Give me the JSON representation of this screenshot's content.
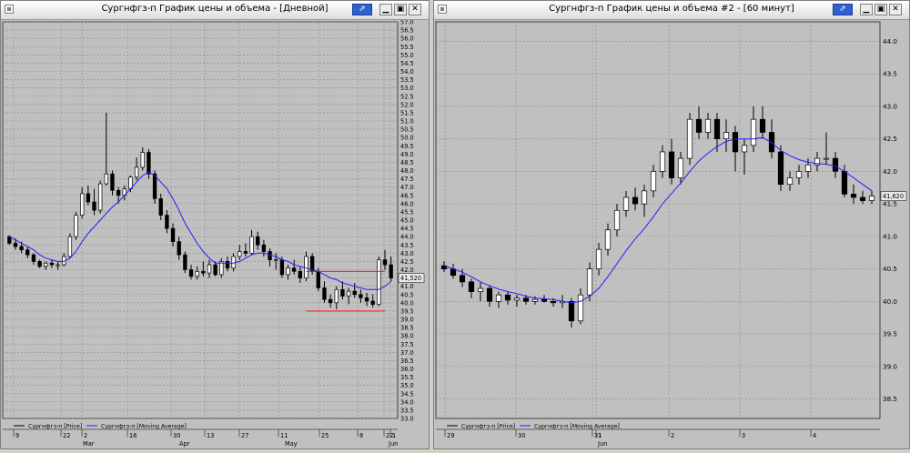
{
  "windows": {
    "left": {
      "title": "Сургнфгз-п График цены и объема - [Дневной]",
      "buttons": {
        "pin": "⇗",
        "minimize": "▁",
        "maximize": "▣",
        "close": "✕"
      }
    },
    "right": {
      "title": "Сургнфгз-п График цены и объема #2 - [60 минут]",
      "buttons": {
        "pin": "⇗",
        "minimize": "▁",
        "maximize": "▣",
        "close": "✕"
      }
    }
  },
  "colors": {
    "price": "#000000",
    "moving_average": "#2020ff",
    "grid": "#8a8a8a",
    "plot_bg": "#c0c0c0",
    "box": "#ff0000"
  },
  "chart_data": [
    {
      "type": "candlestick",
      "interval": "daily",
      "ylim": [
        33.0,
        57.0
      ],
      "y_ticks": [
        "57.0",
        "56.5",
        "56.0",
        "55.5",
        "55.0",
        "54.5",
        "54.0",
        "53.5",
        "53.0",
        "52.5",
        "52.0",
        "51.5",
        "51.0",
        "50.5",
        "50.0",
        "49.5",
        "49.0",
        "48.5",
        "48.0",
        "47.5",
        "47.0",
        "46.5",
        "46.0",
        "45.5",
        "45.0",
        "44.5",
        "44.0",
        "43.5",
        "43.0",
        "42.5",
        "42.0",
        "41.5",
        "41.0",
        "40.5",
        "40.0",
        "39.5",
        "39.0",
        "38.5",
        "38.0",
        "37.5",
        "37.0",
        "36.5",
        "36.0",
        "35.5",
        "35.0",
        "34.5",
        "34.0",
        "33.5",
        "33.0"
      ],
      "x_tick_labels": [
        "9",
        "22",
        "2",
        "16",
        "30",
        "13",
        "27",
        "11",
        "25",
        "8",
        "22",
        "1"
      ],
      "x_month_labels": [
        "Mar",
        "Apr",
        "May",
        "Jun"
      ],
      "current_value_label": "41,520",
      "legend": [
        "Сургнфгз-п [Price]",
        "Сургнфгз-п [Moving Average]"
      ],
      "highlight_box": {
        "y_top": 41.9,
        "y_bottom": 39.5
      },
      "series": [
        {
          "name": "Сургнфгз-п [Price]",
          "kind": "candles",
          "values": [
            [
              44.0,
              44.1,
              43.5,
              43.6
            ],
            [
              43.6,
              43.9,
              43.2,
              43.4
            ],
            [
              43.4,
              43.7,
              43.0,
              43.2
            ],
            [
              43.2,
              43.4,
              42.7,
              42.9
            ],
            [
              42.9,
              43.0,
              42.3,
              42.5
            ],
            [
              42.5,
              42.6,
              42.1,
              42.2
            ],
            [
              42.2,
              42.5,
              42.0,
              42.4
            ],
            [
              42.4,
              42.6,
              42.1,
              42.3
            ],
            [
              42.3,
              42.5,
              42.0,
              42.3
            ],
            [
              42.3,
              43.0,
              42.2,
              42.8
            ],
            [
              42.8,
              44.2,
              42.7,
              44.0
            ],
            [
              44.0,
              45.5,
              43.8,
              45.3
            ],
            [
              45.3,
              47.0,
              45.1,
              46.6
            ],
            [
              46.6,
              47.1,
              45.9,
              46.1
            ],
            [
              46.1,
              46.9,
              45.3,
              45.6
            ],
            [
              45.6,
              47.4,
              45.4,
              47.2
            ],
            [
              47.2,
              51.5,
              47.1,
              47.8
            ],
            [
              47.8,
              48.0,
              46.5,
              46.8
            ],
            [
              46.8,
              47.0,
              46.0,
              46.5
            ],
            [
              46.5,
              47.1,
              46.2,
              46.9
            ],
            [
              46.9,
              47.7,
              46.7,
              47.6
            ],
            [
              47.6,
              48.8,
              47.4,
              48.2
            ],
            [
              48.2,
              49.4,
              48.0,
              49.1
            ],
            [
              49.1,
              49.3,
              47.5,
              47.8
            ],
            [
              47.8,
              48.0,
              46.0,
              46.3
            ],
            [
              46.3,
              46.6,
              45.0,
              45.3
            ],
            [
              45.3,
              45.6,
              44.2,
              44.5
            ],
            [
              44.5,
              44.8,
              43.4,
              43.7
            ],
            [
              43.7,
              44.0,
              42.6,
              42.9
            ],
            [
              42.9,
              43.1,
              41.8,
              42.0
            ],
            [
              42.0,
              42.3,
              41.4,
              41.6
            ],
            [
              41.6,
              42.2,
              41.4,
              41.9
            ],
            [
              41.9,
              42.5,
              41.6,
              41.8
            ],
            [
              41.8,
              42.6,
              41.5,
              42.3
            ],
            [
              42.3,
              42.5,
              41.6,
              41.7
            ],
            [
              41.7,
              42.7,
              41.5,
              42.5
            ],
            [
              42.5,
              42.8,
              41.9,
              42.1
            ],
            [
              42.1,
              43.0,
              41.9,
              42.8
            ],
            [
              42.8,
              43.5,
              42.6,
              43.1
            ],
            [
              43.1,
              43.6,
              42.8,
              43.0
            ],
            [
              43.0,
              44.4,
              42.9,
              44.0
            ],
            [
              44.0,
              44.3,
              43.2,
              43.5
            ],
            [
              43.5,
              43.8,
              42.8,
              43.1
            ],
            [
              43.1,
              43.3,
              42.2,
              42.6
            ],
            [
              42.6,
              43.0,
              42.0,
              42.6
            ],
            [
              42.6,
              42.8,
              41.5,
              41.7
            ],
            [
              41.7,
              42.3,
              41.4,
              42.1
            ],
            [
              42.1,
              42.6,
              41.7,
              41.9
            ],
            [
              41.9,
              42.2,
              41.2,
              41.5
            ],
            [
              41.5,
              43.1,
              41.3,
              42.8
            ],
            [
              42.8,
              43.0,
              41.7,
              41.9
            ],
            [
              41.9,
              42.1,
              40.7,
              40.9
            ],
            [
              40.9,
              41.3,
              40.0,
              40.2
            ],
            [
              40.2,
              40.5,
              39.7,
              40.0
            ],
            [
              40.0,
              41.0,
              39.6,
              40.8
            ],
            [
              40.8,
              41.3,
              40.2,
              40.4
            ],
            [
              40.4,
              40.9,
              39.9,
              40.7
            ],
            [
              40.7,
              41.2,
              40.3,
              40.5
            ],
            [
              40.5,
              40.8,
              40.0,
              40.3
            ],
            [
              40.3,
              40.6,
              39.8,
              40.1
            ],
            [
              40.1,
              40.5,
              39.7,
              39.9
            ],
            [
              39.9,
              42.8,
              39.8,
              42.6
            ],
            [
              42.6,
              43.2,
              42.0,
              42.3
            ],
            [
              42.3,
              42.8,
              41.3,
              41.5
            ]
          ]
        },
        {
          "name": "Сургнфгз-п [Moving Average]",
          "kind": "line",
          "values": [
            44.0,
            43.8,
            43.6,
            43.4,
            43.2,
            42.9,
            42.7,
            42.6,
            42.5,
            42.5,
            42.7,
            43.1,
            43.7,
            44.2,
            44.6,
            45.0,
            45.4,
            45.8,
            46.1,
            46.5,
            46.9,
            47.3,
            47.7,
            47.9,
            47.7,
            47.3,
            46.9,
            46.3,
            45.6,
            44.8,
            44.2,
            43.6,
            43.1,
            42.7,
            42.4,
            42.4,
            42.4,
            42.4,
            42.5,
            42.7,
            42.9,
            43.0,
            43.0,
            42.9,
            42.8,
            42.6,
            42.5,
            42.3,
            42.2,
            42.1,
            42.0,
            41.9,
            41.7,
            41.5,
            41.4,
            41.2,
            41.1,
            41.0,
            40.9,
            40.8,
            40.8,
            40.8,
            41.0,
            41.3
          ]
        }
      ]
    },
    {
      "type": "candlestick",
      "interval": "60 min",
      "ylim": [
        38.2,
        44.3
      ],
      "y_ticks": [
        "44.0",
        "43.5",
        "43.0",
        "42.5",
        "42.0",
        "41.5",
        "41.0",
        "40.5",
        "40.0",
        "39.5",
        "39.0",
        "38.5"
      ],
      "x_tick_labels": [
        "29",
        "30",
        "31",
        "1",
        "2",
        "3",
        "4"
      ],
      "x_month_labels": [
        "Jun"
      ],
      "current_value_label": "41,620",
      "legend": [
        "Сургнфгз-п [Price]",
        "Сургнфгз-п [Moving Average]"
      ],
      "series": [
        {
          "name": "Сургнфгз-п [Price]",
          "kind": "candles",
          "values": [
            [
              40.55,
              40.62,
              40.45,
              40.5
            ],
            [
              40.5,
              40.58,
              40.35,
              40.4
            ],
            [
              40.4,
              40.5,
              40.22,
              40.3
            ],
            [
              40.3,
              40.35,
              40.05,
              40.15
            ],
            [
              40.15,
              40.3,
              40.0,
              40.2
            ],
            [
              40.2,
              40.25,
              39.92,
              40.0
            ],
            [
              40.0,
              40.15,
              39.9,
              40.1
            ],
            [
              40.1,
              40.15,
              39.95,
              40.02
            ],
            [
              40.02,
              40.1,
              39.92,
              40.05
            ],
            [
              40.05,
              40.1,
              39.95,
              40.0
            ],
            [
              40.0,
              40.08,
              39.95,
              40.03
            ],
            [
              40.03,
              40.1,
              39.98,
              40.0
            ],
            [
              40.0,
              40.05,
              39.92,
              39.98
            ],
            [
              39.98,
              40.1,
              39.9,
              40.0
            ],
            [
              40.0,
              40.05,
              39.6,
              39.7
            ],
            [
              39.7,
              40.2,
              39.65,
              40.1
            ],
            [
              40.1,
              40.6,
              40.0,
              40.5
            ],
            [
              40.5,
              40.9,
              40.4,
              40.8
            ],
            [
              40.8,
              41.2,
              40.7,
              41.1
            ],
            [
              41.1,
              41.5,
              41.0,
              41.4
            ],
            [
              41.4,
              41.7,
              41.3,
              41.6
            ],
            [
              41.6,
              41.75,
              41.4,
              41.5
            ],
            [
              41.5,
              41.8,
              41.3,
              41.7
            ],
            [
              41.7,
              42.1,
              41.6,
              42.0
            ],
            [
              42.0,
              42.4,
              41.9,
              42.3
            ],
            [
              42.3,
              42.5,
              41.8,
              41.9
            ],
            [
              41.9,
              42.3,
              41.8,
              42.2
            ],
            [
              42.2,
              42.9,
              42.1,
              42.8
            ],
            [
              42.8,
              43.0,
              42.5,
              42.6
            ],
            [
              42.6,
              42.9,
              42.5,
              42.8
            ],
            [
              42.8,
              42.9,
              42.3,
              42.5
            ],
            [
              42.5,
              42.8,
              42.3,
              42.6
            ],
            [
              42.6,
              42.7,
              42.0,
              42.3
            ],
            [
              42.3,
              42.5,
              41.95,
              42.4
            ],
            [
              42.4,
              43.0,
              42.3,
              42.8
            ],
            [
              42.8,
              43.0,
              42.5,
              42.6
            ],
            [
              42.6,
              42.8,
              42.2,
              42.3
            ],
            [
              42.3,
              42.4,
              41.7,
              41.8
            ],
            [
              41.8,
              42.0,
              41.7,
              41.9
            ],
            [
              41.9,
              42.1,
              41.8,
              42.0
            ],
            [
              42.0,
              42.2,
              41.9,
              42.1
            ],
            [
              42.1,
              42.3,
              42.0,
              42.2
            ],
            [
              42.2,
              42.6,
              42.1,
              42.2
            ],
            [
              42.2,
              42.3,
              41.9,
              42.0
            ],
            [
              42.0,
              42.1,
              41.6,
              41.65
            ],
            [
              41.65,
              41.8,
              41.5,
              41.6
            ],
            [
              41.6,
              41.7,
              41.5,
              41.55
            ],
            [
              41.55,
              41.7,
              41.5,
              41.62
            ]
          ]
        },
        {
          "name": "Сургнфгз-п [Moving Average]",
          "kind": "line",
          "values": [
            40.55,
            40.5,
            40.45,
            40.38,
            40.3,
            40.24,
            40.19,
            40.15,
            40.12,
            40.08,
            40.05,
            40.04,
            40.03,
            40.0,
            39.98,
            40.0,
            40.08,
            40.2,
            40.38,
            40.58,
            40.78,
            40.96,
            41.12,
            41.3,
            41.5,
            41.66,
            41.82,
            42.0,
            42.16,
            42.28,
            42.38,
            42.46,
            42.5,
            42.5,
            42.5,
            42.52,
            42.44,
            42.32,
            42.24,
            42.18,
            42.14,
            42.12,
            42.11,
            42.08,
            42.0,
            41.9,
            41.8,
            41.7
          ]
        }
      ]
    }
  ]
}
